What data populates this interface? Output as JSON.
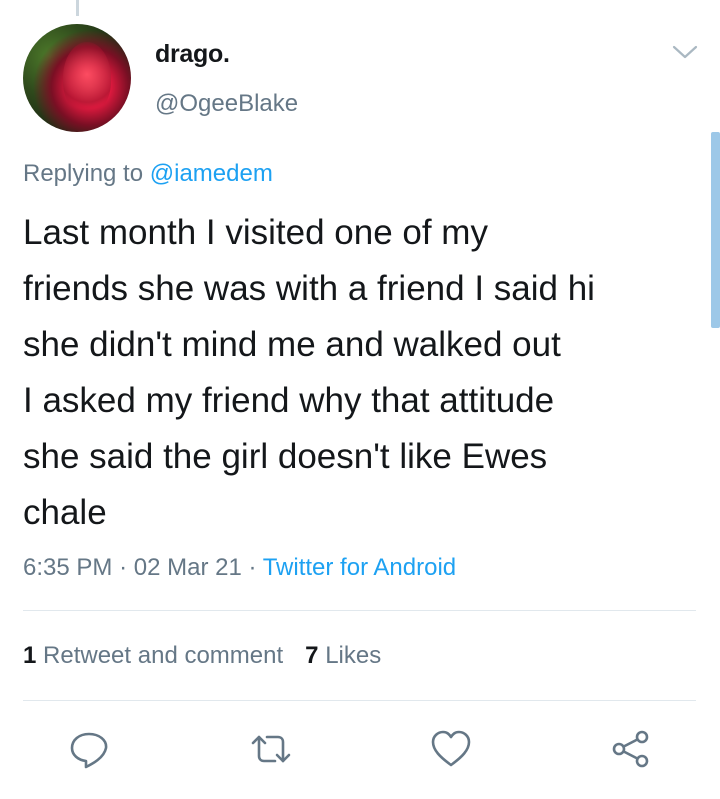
{
  "tweet": {
    "display_name": "drago.",
    "handle": "@OgeeBlake",
    "replying_prefix": "Replying to",
    "replying_to": "@iamedem",
    "text": "Last month I visited one of my\nfriends she was with a friend I said hi\nshe didn't mind me and walked out\nI asked my friend why that attitude\nshe said the girl doesn't like Ewes\nchale",
    "time": "6:35 PM",
    "date": "02 Mar 21",
    "source": "Twitter for Android"
  },
  "stats": {
    "retweet_count": "1",
    "retweet_label": "Retweet and comment",
    "like_count": "7",
    "like_label": "Likes"
  },
  "icons": {
    "chevron": "chevron-down-icon",
    "reply": "reply-icon",
    "retweet": "retweet-icon",
    "like": "heart-icon",
    "share": "share-icon"
  },
  "colors": {
    "link": "#1da1f2",
    "secondary_text": "#657786",
    "primary_text": "#14171a",
    "icon": "#657786"
  }
}
